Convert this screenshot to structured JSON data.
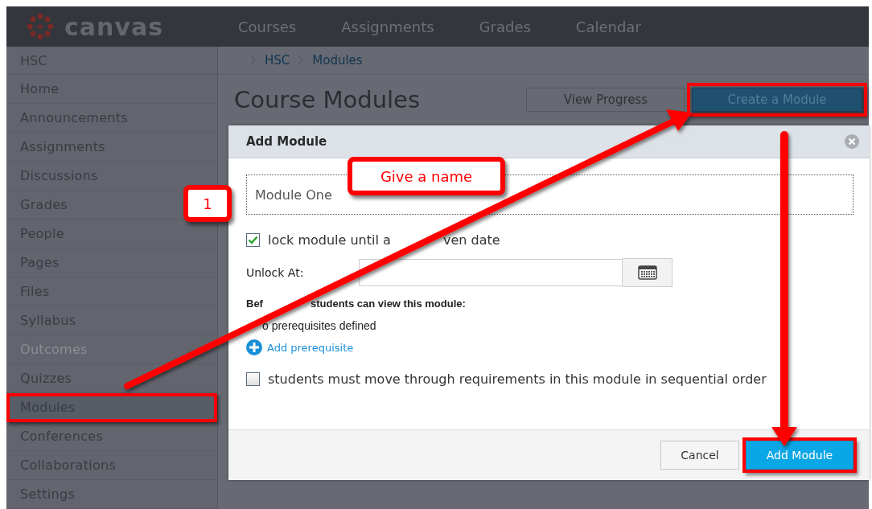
{
  "logo": {
    "text": "canvas"
  },
  "top_nav": [
    {
      "label": "Courses"
    },
    {
      "label": "Assignments"
    },
    {
      "label": "Grades"
    },
    {
      "label": "Calendar"
    }
  ],
  "sidebar": {
    "title": "HSC",
    "items": [
      {
        "label": "Home",
        "disabled": false,
        "annotated": false
      },
      {
        "label": "Announcements",
        "disabled": false,
        "annotated": false
      },
      {
        "label": "Assignments",
        "disabled": false,
        "annotated": false
      },
      {
        "label": "Discussions",
        "disabled": false,
        "annotated": false
      },
      {
        "label": "Grades",
        "disabled": false,
        "annotated": false
      },
      {
        "label": "People",
        "disabled": false,
        "annotated": false
      },
      {
        "label": "Pages",
        "disabled": false,
        "annotated": false
      },
      {
        "label": "Files",
        "disabled": false,
        "annotated": false
      },
      {
        "label": "Syllabus",
        "disabled": false,
        "annotated": false
      },
      {
        "label": "Outcomes",
        "disabled": true,
        "annotated": false
      },
      {
        "label": "Quizzes",
        "disabled": false,
        "annotated": false
      },
      {
        "label": "Modules",
        "disabled": false,
        "annotated": true
      },
      {
        "label": "Conferences",
        "disabled": false,
        "annotated": false
      },
      {
        "label": "Collaborations",
        "disabled": false,
        "annotated": false
      },
      {
        "label": "Settings",
        "disabled": false,
        "annotated": false
      }
    ]
  },
  "breadcrumbs": [
    "HSC",
    "Modules"
  ],
  "page_title": "Course Modules",
  "header_buttons": [
    {
      "label": "View Progress",
      "kind": "secondary",
      "annotated": false
    },
    {
      "label": "Create a Module",
      "kind": "primary",
      "annotated": true
    }
  ],
  "dialog": {
    "title": "Add Module",
    "name_value": "Module One",
    "lock": {
      "label_parts": [
        "lock module until a",
        "ven date"
      ],
      "checked": true
    },
    "unlock_label": "Unlock At:",
    "prereq_heading_parts": [
      "Bef",
      "students can view this module:"
    ],
    "prereq_empty": "o prerequisites defined",
    "add_prereq": "Add prerequisite",
    "sequential": {
      "label": "students must move through requirements in this module in sequential order",
      "checked": false
    },
    "buttons": [
      {
        "label": "Cancel",
        "kind": "secondary",
        "annotated": false
      },
      {
        "label": "Add Module",
        "kind": "primary",
        "annotated": true
      }
    ]
  },
  "annotations": {
    "step_number": "1",
    "callout": "Give a name"
  }
}
